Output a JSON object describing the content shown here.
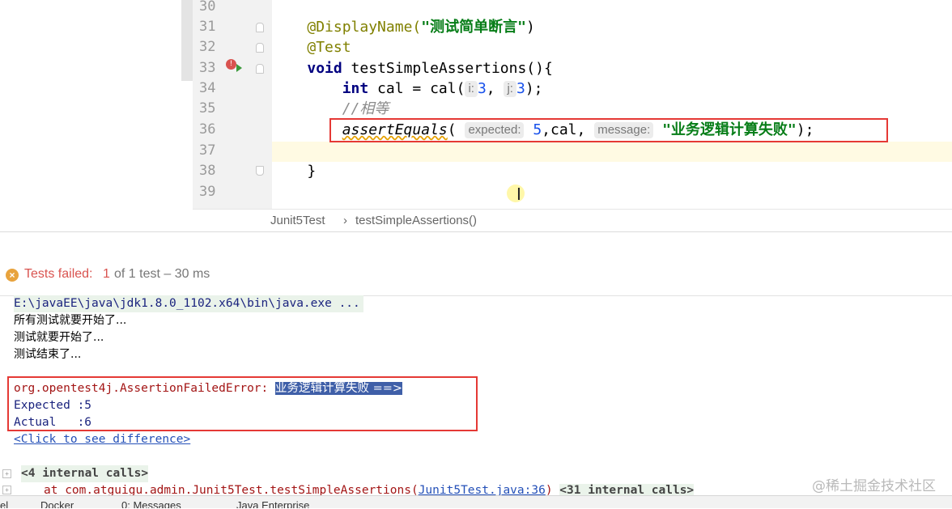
{
  "editor": {
    "line_numbers": [
      "30",
      "31",
      "32",
      "33",
      "34",
      "35",
      "36",
      "37",
      "38",
      "39"
    ],
    "line31": {
      "annotation": "@DisplayName(",
      "string": "\"测试简单断言\"",
      "close": ")"
    },
    "line32": {
      "annotation": "@Test"
    },
    "line33": {
      "keyword": "void",
      "rest": " testSimpleAssertions(){"
    },
    "line34": {
      "keyword": "int",
      "rest1": " cal = cal(",
      "hint_i": "i:",
      "num1": "3",
      "comma": ", ",
      "hint_j": "j:",
      "num2": "3",
      "close": ");"
    },
    "line35": {
      "comment": "//相等"
    },
    "line36": {
      "method": "assertEquals",
      "open": "(",
      "hint_expected": "expected:",
      "num": "5",
      "mid": ",cal, ",
      "hint_message": "message:",
      "string": "\"业务逻辑计算失败\"",
      "close": ");"
    },
    "line38": {
      "brace": "}"
    },
    "breadcrumb": {
      "class_name": "Junit5Test",
      "separator": "›",
      "method_name": "testSimpleAssertions()"
    }
  },
  "run_panel": {
    "status": {
      "label": "Tests failed:",
      "count": "1",
      "rest": "of 1 test – 30 ms"
    },
    "console": {
      "java_cmd": "E:\\javaEE\\java\\jdk1.8.0_1102.x64\\bin\\java.exe ...",
      "out1": "所有测试就要开始了...",
      "out2": "测试就要开始了...",
      "out3": "测试结束了...",
      "error_class": "org.opentest4j.AssertionFailedError: ",
      "error_message": "业务逻辑计算失败 ==>",
      "expected": "Expected :5",
      "actual": "Actual   :6",
      "diff_link": "<Click to see difference>",
      "internal_calls": "<4 internal calls>",
      "stack_prefix": "at com.atguigu.admin.Junit5Test.testSimpleAssertions(",
      "stack_link": "Junit5Test.java:36",
      "stack_suffix": ")",
      "stack_internal": "<31 internal calls>"
    }
  },
  "bottom_tabs": {
    "tab0": "el",
    "tab1": "Docker",
    "tab2": "0: Messages",
    "tab3": "Java Enterprise"
  },
  "watermark": "@稀土掘金技术社区",
  "colors": {
    "highlight_box": "#e53935",
    "selection": "#3f5fa8",
    "status_fail": "#d9534f"
  }
}
